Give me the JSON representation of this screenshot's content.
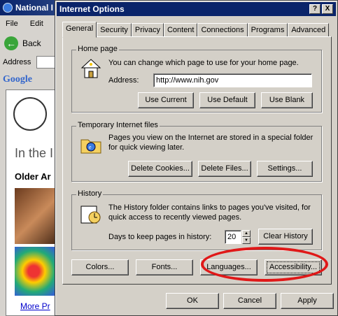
{
  "background_window": {
    "title": "National I",
    "menu": [
      "File",
      "Edit"
    ],
    "back_label": "Back",
    "address_label": "Address",
    "google_label": "Google",
    "heading_partial": "In the I",
    "subheading_partial": "Older Ar",
    "more_link": "More Pr"
  },
  "dialog": {
    "title": "Internet Options",
    "help_button": "?",
    "close_button": "X",
    "tabs": [
      {
        "label": "General",
        "active": true
      },
      {
        "label": "Security"
      },
      {
        "label": "Privacy"
      },
      {
        "label": "Content"
      },
      {
        "label": "Connections"
      },
      {
        "label": "Programs"
      },
      {
        "label": "Advanced"
      }
    ],
    "home_page": {
      "group_label": "Home page",
      "description": "You can change which page to use for your home page.",
      "address_label": "Address:",
      "address_value": "http://www.nih.gov",
      "use_current": "Use Current",
      "use_default": "Use Default",
      "use_blank": "Use Blank"
    },
    "temp_files": {
      "group_label": "Temporary Internet files",
      "description_1": "Pages you view on the Internet are stored in a special folder",
      "description_2": "for quick viewing later.",
      "delete_cookies": "Delete Cookies...",
      "delete_files": "Delete Files...",
      "settings": "Settings..."
    },
    "history": {
      "group_label": "History",
      "description_1": "The History folder contains links to pages you've visited, for",
      "description_2": "quick access to recently viewed pages.",
      "days_label": "Days to keep pages in history:",
      "days_value": "20",
      "clear_history": "Clear History"
    },
    "bottom_buttons": {
      "colors": "Colors...",
      "fonts": "Fonts...",
      "languages": "Languages...",
      "accessibility": "Accessibility..."
    },
    "footer": {
      "ok": "OK",
      "cancel": "Cancel",
      "apply": "Apply"
    },
    "highlight_color": "#e01818"
  }
}
